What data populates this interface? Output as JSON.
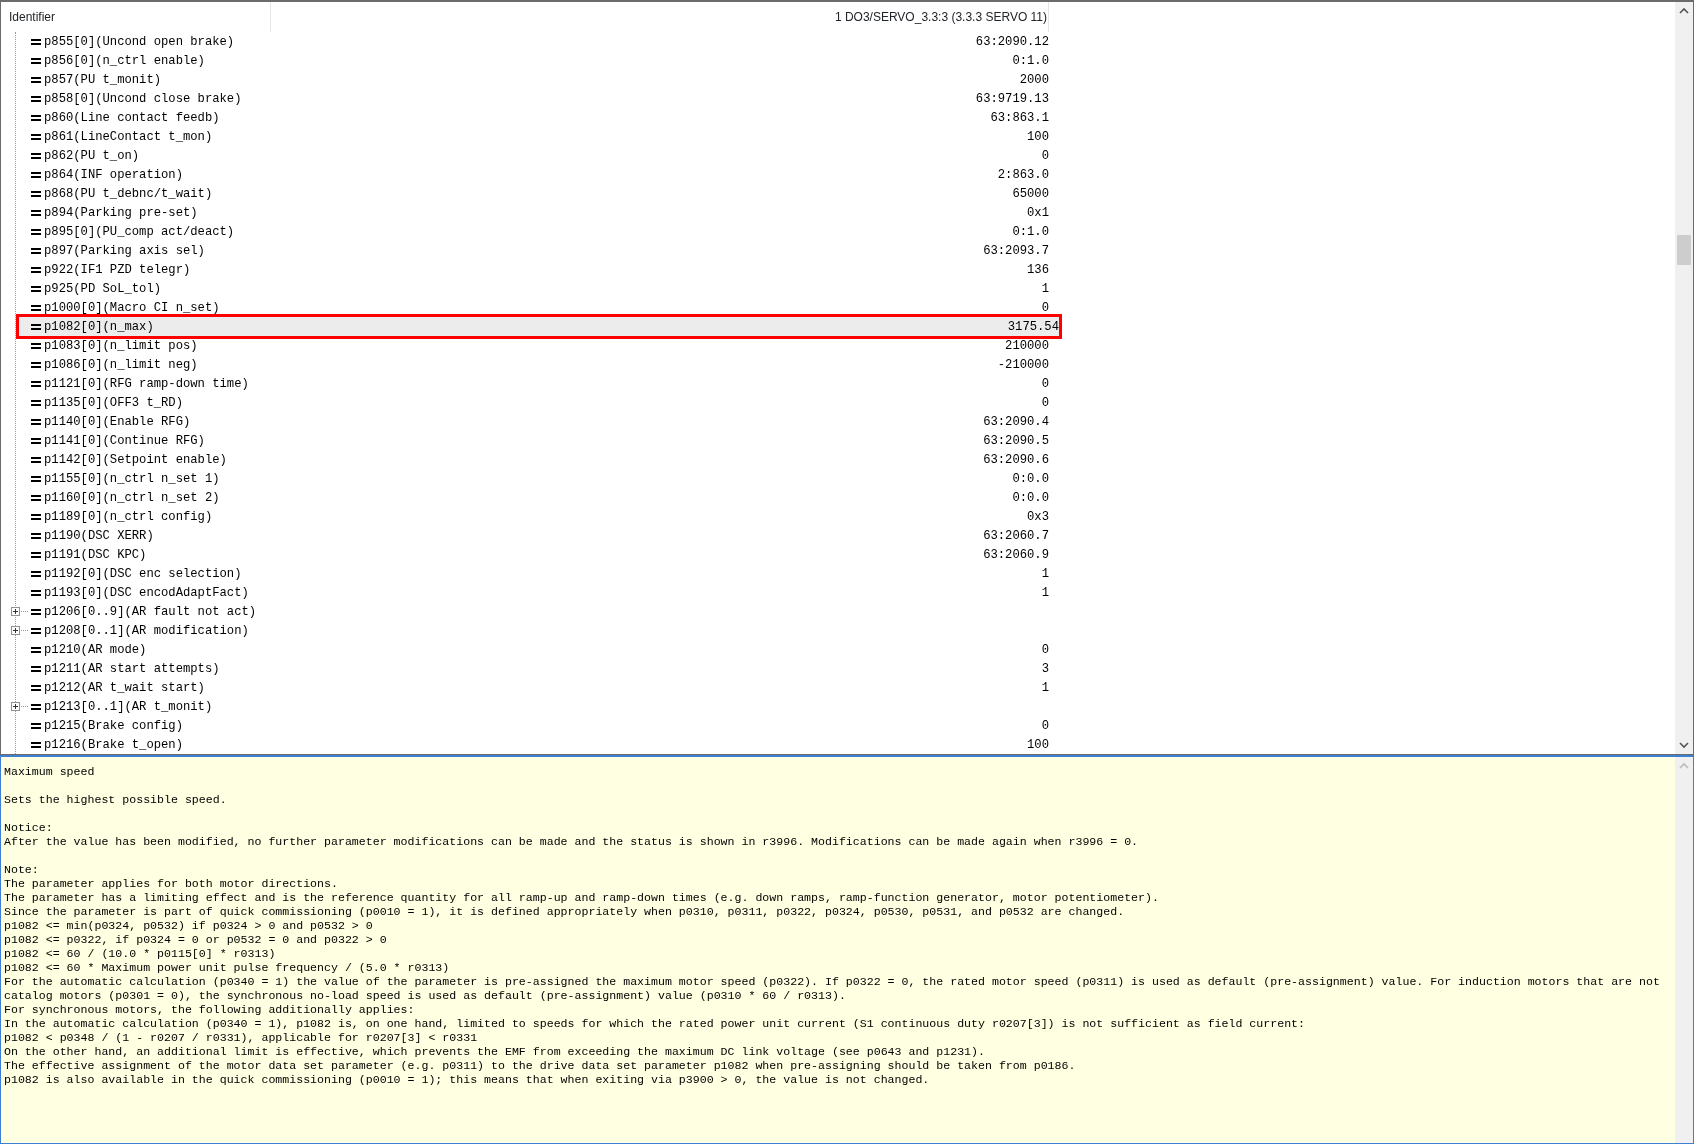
{
  "columns": [
    "Identifier",
    "1 DO3/SERVO_3.3:3 (3.3.3 SERVO 11)"
  ],
  "rows": [
    {
      "kind": "leaf",
      "name": "p855[0](Uncond open brake)",
      "value": "63:2090.12",
      "selected": false
    },
    {
      "kind": "leaf",
      "name": "p856[0](n_ctrl enable)",
      "value": "0:1.0",
      "selected": false
    },
    {
      "kind": "leaf",
      "name": "p857(PU t_monit)",
      "value": "2000",
      "selected": false
    },
    {
      "kind": "leaf",
      "name": "p858[0](Uncond close brake)",
      "value": "63:9719.13",
      "selected": false
    },
    {
      "kind": "leaf",
      "name": "p860(Line contact feedb)",
      "value": "63:863.1",
      "selected": false
    },
    {
      "kind": "leaf",
      "name": "p861(LineContact t_mon)",
      "value": "100",
      "selected": false
    },
    {
      "kind": "leaf",
      "name": "p862(PU t_on)",
      "value": "0",
      "selected": false
    },
    {
      "kind": "leaf",
      "name": "p864(INF operation)",
      "value": "2:863.0",
      "selected": false
    },
    {
      "kind": "leaf",
      "name": "p868(PU t_debnc/t_wait)",
      "value": "65000",
      "selected": false
    },
    {
      "kind": "leaf",
      "name": "p894(Parking pre-set)",
      "value": "0x1",
      "selected": false
    },
    {
      "kind": "leaf",
      "name": "p895[0](PU_comp act/deact)",
      "value": "0:1.0",
      "selected": false
    },
    {
      "kind": "leaf",
      "name": "p897(Parking axis sel)",
      "value": "63:2093.7",
      "selected": false
    },
    {
      "kind": "leaf",
      "name": "p922(IF1 PZD telegr)",
      "value": "136",
      "selected": false
    },
    {
      "kind": "leaf",
      "name": "p925(PD SoL_tol)",
      "value": "1",
      "selected": false
    },
    {
      "kind": "leaf",
      "name": "p1000[0](Macro CI n_set)",
      "value": "0",
      "selected": false
    },
    {
      "kind": "leaf",
      "name": "p1082[0](n_max)",
      "value": "3175.54",
      "selected": true
    },
    {
      "kind": "leaf",
      "name": "p1083[0](n_limit pos)",
      "value": "210000",
      "selected": false
    },
    {
      "kind": "leaf",
      "name": "p1086[0](n_limit neg)",
      "value": "-210000",
      "selected": false
    },
    {
      "kind": "leaf",
      "name": "p1121[0](RFG ramp-down time)",
      "value": "0",
      "selected": false
    },
    {
      "kind": "leaf",
      "name": "p1135[0](OFF3 t_RD)",
      "value": "0",
      "selected": false
    },
    {
      "kind": "leaf",
      "name": "p1140[0](Enable RFG)",
      "value": "63:2090.4",
      "selected": false
    },
    {
      "kind": "leaf",
      "name": "p1141[0](Continue RFG)",
      "value": "63:2090.5",
      "selected": false
    },
    {
      "kind": "leaf",
      "name": "p1142[0](Setpoint enable)",
      "value": "63:2090.6",
      "selected": false
    },
    {
      "kind": "leaf",
      "name": "p1155[0](n_ctrl n_set 1)",
      "value": "0:0.0",
      "selected": false
    },
    {
      "kind": "leaf",
      "name": "p1160[0](n_ctrl n_set 2)",
      "value": "0:0.0",
      "selected": false
    },
    {
      "kind": "leaf",
      "name": "p1189[0](n_ctrl config)",
      "value": "0x3",
      "selected": false
    },
    {
      "kind": "leaf",
      "name": "p1190(DSC XERR)",
      "value": "63:2060.7",
      "selected": false
    },
    {
      "kind": "leaf",
      "name": "p1191(DSC KPC)",
      "value": "63:2060.9",
      "selected": false
    },
    {
      "kind": "leaf",
      "name": "p1192[0](DSC enc selection)",
      "value": "1",
      "selected": false
    },
    {
      "kind": "leaf",
      "name": "p1193[0](DSC encodAdaptFact)",
      "value": "1",
      "selected": false
    },
    {
      "kind": "group",
      "name": "p1206[0..9](AR fault not act)",
      "selected": false
    },
    {
      "kind": "group",
      "name": "p1208[0..1](AR modification)",
      "selected": false
    },
    {
      "kind": "leaf",
      "name": "p1210(AR mode)",
      "value": "0",
      "selected": false
    },
    {
      "kind": "leaf",
      "name": "p1211(AR start attempts)",
      "value": "3",
      "selected": false
    },
    {
      "kind": "leaf",
      "name": "p1212(AR t_wait start)",
      "value": "1",
      "selected": false
    },
    {
      "kind": "group",
      "name": "p1213[0..1](AR t_monit)",
      "selected": false
    },
    {
      "kind": "leaf",
      "name": "p1215(Brake config)",
      "value": "0",
      "selected": false
    },
    {
      "kind": "leaf",
      "name": "p1216(Brake t_open)",
      "value": "100",
      "selected": false
    }
  ],
  "help": {
    "paragraphs": [
      [
        "Maximum speed"
      ],
      [
        "Sets the highest possible speed."
      ],
      [
        "Notice:",
        "After the value has been modified, no further parameter modifications can be made and the status is shown in r3996. Modifications can be made again when r3996 = 0."
      ],
      [
        "Note:",
        "The parameter applies for both motor directions.",
        "The parameter has a limiting effect and is the reference quantity for all ramp-up and ramp-down times (e.g. down ramps, ramp-function generator, motor potentiometer).",
        "Since the parameter is part of quick commissioning (p0010 = 1), it is defined appropriately when p0310, p0311, p0322, p0324, p0530, p0531, and p0532 are changed.",
        "p1082 <= min(p0324, p0532) if p0324 > 0 and p0532 > 0",
        "p1082 <= p0322, if p0324 = 0 or p0532 = 0 and p0322 > 0",
        "p1082 <= 60 / (10.0 * p0115[0] * r0313)",
        "p1082 <= 60 * Maximum power unit pulse frequency / (5.0 * r0313)",
        "For the automatic calculation (p0340 = 1) the value of the parameter is pre-assigned the maximum motor speed (p0322). If p0322 = 0, the rated motor speed (p0311) is used as default (pre-assignment) value. For induction motors that are not",
        "catalog motors (p0301 = 0), the synchronous no-load speed is used as default (pre-assignment) value (p0310 * 60 / r0313).",
        "For synchronous motors, the following additionally applies:",
        "In the automatic calculation (p0340 = 1), p1082 is, on one hand, limited to speeds for which the rated power unit current (S1 continuous duty r0207[3]) is not sufficient as field current:",
        "p1082 < p0348 / (1 - r0207 / r0331), applicable for r0207[3] < r0331",
        "On the other hand, an additional limit is effective, which prevents the EMF from exceeding the maximum DC link voltage (see p0643 and p1231).",
        "The effective assignment of the motor data set parameter (e.g. p0311) to the drive data set parameter p1082 when pre-assigning should be taken from p0186.",
        "p1082 is also available in the quick commissioning (p0010 = 1); this means that when exiting via p3900 > 0, the value is not changed."
      ]
    ]
  }
}
